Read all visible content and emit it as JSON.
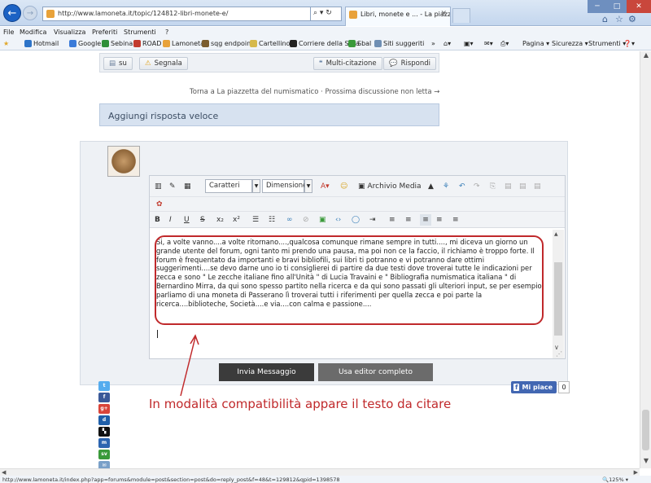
{
  "browser": {
    "address": "http://www.lamoneta.it/topic/124812-libri-monete-e/",
    "address_tools": "⌕ ▾ ↻",
    "tab_title": "Libri, monete e ... - La piazz...",
    "tab_close": "✕",
    "window_buttons": {
      "minimize": "─",
      "maximize": "□",
      "close": "✕"
    },
    "menu": [
      "File",
      "Modifica",
      "Visualizza",
      "Preferiti",
      "Strumenti",
      "?"
    ],
    "favorites": [
      {
        "label": "Hotmail",
        "color": "#2e74c8"
      },
      {
        "label": "Google",
        "color": "#3b7bd9"
      },
      {
        "label": "Sebina",
        "color": "#2f8f3a"
      },
      {
        "label": "ROAD",
        "color": "#c23b2e"
      },
      {
        "label": "Lamoneta",
        "color": "#e8a23a"
      },
      {
        "label": "sqg endpoint",
        "color": "#7a5c2e"
      },
      {
        "label": "Cartellino",
        "color": "#d6b94c"
      },
      {
        "label": "Corriere della Sera",
        "color": "#222222"
      },
      {
        "label": "Sbal",
        "color": "#3a9a3a"
      },
      {
        "label": "Siti suggeriti",
        "color": "#6f8fb4"
      }
    ],
    "commands": [
      "Pagina ▾",
      "Sicurezza ▾",
      "Strumenti ▾"
    ],
    "status_url": "http://www.lamoneta.it/index.php?app=forums&module=post&section=post&do=reply_post&f=48&t=129812&qpid=1398578",
    "zoom": "🔍125% ▾"
  },
  "forum": {
    "actions": {
      "su": "su",
      "segnala": "Segnala",
      "multi": "Multi-citazione",
      "rispondi": "Rispondi"
    },
    "topic_nav": "Torna a La piazzetta del numismatico · Prossima discussione non letta →",
    "quick_reply_title": "Aggiungi risposta veloce",
    "editor": {
      "font_select": "Caratteri",
      "size_select": "Dimensione",
      "archive_label": "Archivio Media",
      "text": "Si, a volte vanno....a volte ritornano....,qualcosa comunque rimane sempre in tutti...., mi diceva un giorno un grande utente del forum, ogni tanto mi prendo una pausa, ma poi non ce la faccio, il richiamo è troppo forte. Il forum è frequentato da importanti e bravi bibliofili, sui libri ti potranno e vi potranno dare ottimi suggerimenti....se devo darne uno io ti consiglierei di partire da due testi dove troverai tutte le indicazioni per zecca e sono \" Le zecche italiane fino all'Unità \" di Lucia Travaini e \" Bibliografia numismatica italiana \" di Bernardino Mirra, da qui sono spesso partito nella ricerca e da qui sono passati gli ulteriori input, se per esempio parliamo di una moneta di Passerano lì troverai tutti i riferimenti per quella zecca e poi parte la ricerca....biblioteche, Società....e via....con calma e passione...."
    },
    "send_button": "Invia Messaggio",
    "full_editor_button": "Usa editor completo",
    "annotation": "In modalità compatibilità appare il testo da citare",
    "fb_like": "Mi piace",
    "fb_count": "0"
  }
}
